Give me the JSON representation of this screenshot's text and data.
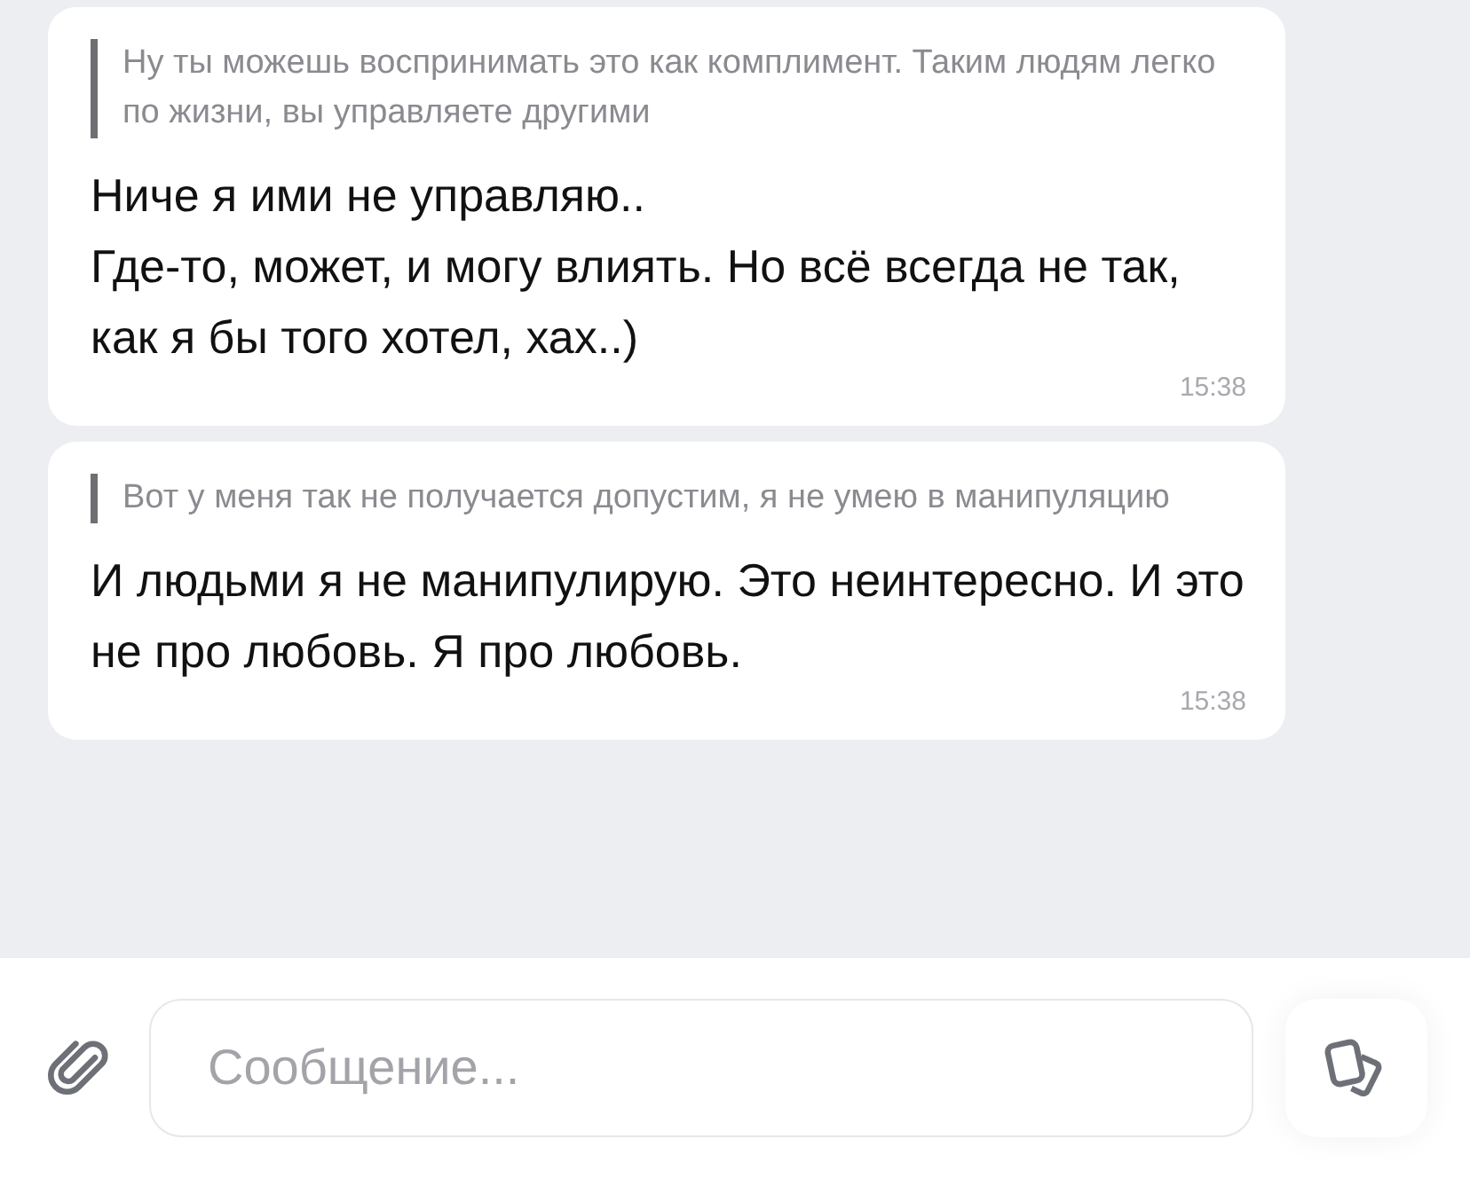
{
  "messages": [
    {
      "quote": "Ну ты можешь воспринимать это как комплимент. Таким людям легко по жизни, вы управляете другими",
      "text": "Ниче я ими не управляю..\nГде-то, может, и могу влиять. Но всё всегда не так, как я бы того хотел, хах..)",
      "time": "15:38"
    },
    {
      "quote": "Вот у меня так не получается допустим, я не умею в манипуляцию",
      "text": "И людьми я не манипулирую. Это неинтересно. И это не про любовь. Я про любовь.",
      "time": "15:38"
    }
  ],
  "composer": {
    "placeholder": "Сообщение..."
  }
}
